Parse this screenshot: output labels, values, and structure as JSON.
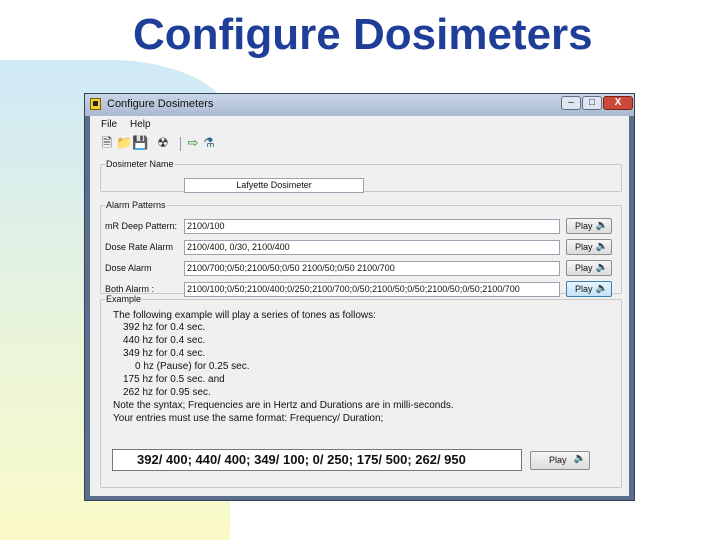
{
  "slide": {
    "title": "Configure Dosimeters"
  },
  "window": {
    "title": "Configure Dosimeters",
    "controls": {
      "minimize": "–",
      "maximize": "□",
      "close": "X"
    }
  },
  "menu": {
    "items": [
      "File",
      "Help"
    ]
  },
  "toolbar": {
    "icons": [
      "new-file-icon",
      "open-folder-icon",
      "save-icon",
      "dosimeter-icon",
      "import-icon",
      "export-icon"
    ]
  },
  "dosimeter": {
    "legend": "Dosimeter Name",
    "name_value": "Lafyette Dosimeter"
  },
  "alarm_patterns": {
    "legend": "Alarm Patterns",
    "play_label": "Play",
    "rows": [
      {
        "label": "mR Deep Pattern:",
        "value": "2100/100"
      },
      {
        "label": "Dose Rate Alarm",
        "value": "2100/400, 0/30, 2100/400"
      },
      {
        "label": "Dose Alarm",
        "value": "2100/700;0/50;2100/50;0/50 2100/50;0/50 2100/700"
      },
      {
        "label": "Both Alarm :",
        "value": "2100/100;0/50;2100/400;0/250;2100/700;0/50;2100/50;0/50;2100/50;0/50;2100/700"
      }
    ]
  },
  "example": {
    "legend": "Example",
    "lines": [
      "The following example will play a series of tones as follows:",
      "392 hz for 0.4 sec.",
      "440 hz for 0.4 sec.",
      "349 hz for 0.4 sec.",
      "0 hz (Pause) for 0.25 sec.",
      "175 hz for 0.5 sec. and",
      "262 hz for 0.95 sec.",
      "Note the syntax; Frequencies are in Hertz and Durations are in milli-seconds.",
      "Your entries must use the same format: Frequency/ Duration;"
    ],
    "sample_value": "392/ 400; 440/ 400; 349/ 100; 0/ 250; 175/ 500; 262/ 950",
    "play_label": "Play"
  },
  "colors": {
    "title": "#1f3e97",
    "window_frame": "#5b6e8b",
    "client_bg": "#f0f0f0",
    "close_button": "#c94a3a"
  }
}
